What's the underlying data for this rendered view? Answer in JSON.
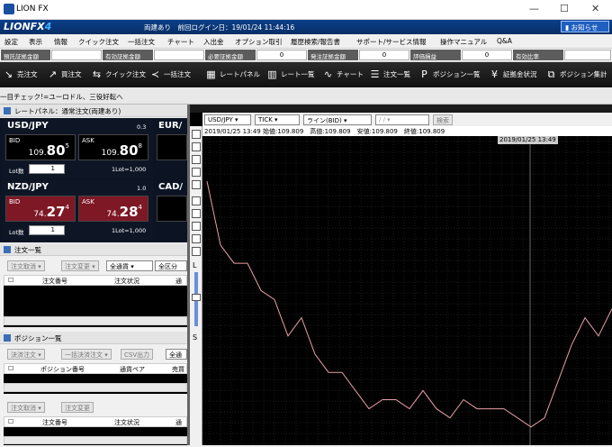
{
  "window": {
    "title": "LION FX",
    "min": "—",
    "max": "☐",
    "close": "✕"
  },
  "header": {
    "brand_main": "LIONFX",
    "brand_ver": "4",
    "login_info": "両建あり　前回ログイン日：19/01/24 11:44:16",
    "notice": "お知らせ"
  },
  "menu": [
    "設定",
    "表示",
    "情報",
    "クイック注文",
    "一括注文",
    "チャート",
    "入出金",
    "オプション取引",
    "履歴検索/報告書",
    "サポート/サービス情報",
    "操作マニュアル",
    "Q&A"
  ],
  "account": [
    {
      "label": "預託証拠金額",
      "value": ""
    },
    {
      "label": "有効証拠金額",
      "value": ""
    },
    {
      "label": "必要証拠金額",
      "value": "0"
    },
    {
      "label": "発注証拠金額",
      "value": "0"
    },
    {
      "label": "評価損益",
      "value": "0"
    },
    {
      "label": "有効比率",
      "value": ""
    }
  ],
  "toolbar": [
    {
      "label": "売注文",
      "icon": "sell-arrow-icon"
    },
    {
      "label": "買注文",
      "icon": "buy-arrow-icon"
    },
    {
      "label": "クイック注文",
      "icon": "quick-order-icon"
    },
    {
      "label": "一括注文",
      "icon": "bulk-order-icon"
    },
    {
      "label": "レートパネル",
      "icon": "rate-panel-icon"
    },
    {
      "label": "レート一覧",
      "icon": "rate-list-icon"
    },
    {
      "label": "チャート",
      "icon": "chart-icon"
    },
    {
      "label": "注文一覧",
      "icon": "order-list-icon"
    },
    {
      "label": "ポジション一覧",
      "icon": "position-list-icon"
    },
    {
      "label": "証拠金状況",
      "icon": "yen-icon"
    },
    {
      "label": "ポジション集計",
      "icon": "position-summary-icon"
    }
  ],
  "ticker": "一目チェック!=ユーロドル、三役好転へ",
  "rate_panel": {
    "title": "レートパネル：通常注文(両建あり)",
    "cards": [
      {
        "pair": "USD/JPY",
        "spread": "0.3",
        "bid_label": "BID",
        "ask_label": "ASK",
        "bid_pre": "109.",
        "bid_big": "80",
        "bid_sup": "5",
        "ask_pre": "109.",
        "ask_big": "80",
        "ask_sup": "8",
        "lot_label": "Lot数",
        "lot": "1",
        "lot_unit": "1Lot=1,000"
      },
      {
        "pair": "NZD/JPY",
        "spread": "1.0",
        "bid_label": "BID",
        "ask_label": "ASK",
        "bid_pre": "74.",
        "bid_big": "27",
        "bid_sup": "4",
        "ask_pre": "74.",
        "ask_big": "28",
        "ask_sup": "4",
        "lot_label": "Lot数",
        "lot": "1",
        "lot_unit": "1Lot=1,000"
      }
    ],
    "partial_pairs": [
      "EUR/",
      "CAD/"
    ]
  },
  "orders": {
    "title": "注文一覧",
    "cancel": "注文取消",
    "change": "注文変更",
    "currency": "全通貨",
    "kind": "全区分",
    "cols": [
      "注文番号",
      "注文状況",
      "通貨"
    ]
  },
  "positions": {
    "title": "ポジション一覧",
    "settle": "決済注文",
    "bulk_settle": "一括決済注文",
    "csv": "CSV出力",
    "currency": "全通",
    "cols": [
      "ポジション番号",
      "通貨ペア",
      "売買"
    ]
  },
  "orders2": {
    "cancel": "注文取消",
    "change": "注文変更",
    "cols": [
      "注文番号",
      "注文状況",
      "通貨"
    ]
  },
  "chart": {
    "pair": "USD/JPY",
    "period": "TICK",
    "type": "ライン(BID)",
    "date": "/ /",
    "search": "検索",
    "info": "2019/01/25 13:49 始値:109.809　高値:109.809　安値:109.809　終値:109.809",
    "cursor_label": "2019/01/25 13:49",
    "scale_l": "L",
    "scale_s": "S"
  },
  "chart_data": {
    "type": "line",
    "series": [
      {
        "values": [
          109.95,
          109.88,
          109.86,
          109.86,
          109.83,
          109.82,
          109.78,
          109.8,
          109.76,
          109.74,
          109.74,
          109.72,
          109.7,
          109.71,
          109.71,
          109.7,
          109.72,
          109.7,
          109.69,
          109.71,
          109.7,
          109.7,
          109.7,
          109.69,
          109.68,
          109.69,
          109.73,
          109.77,
          109.8,
          109.78,
          109.81
        ]
      }
    ],
    "colors": {
      "line": "#e8a0a8",
      "grid": "#3a3a3a"
    }
  }
}
